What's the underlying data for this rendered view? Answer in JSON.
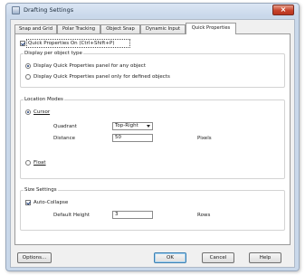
{
  "window": {
    "title": "Drafting Settings",
    "close_glyph": "×"
  },
  "tabs": [
    {
      "label": "Snap and Grid"
    },
    {
      "label": "Polar Tracking"
    },
    {
      "label": "Object Snap"
    },
    {
      "label": "Dynamic Input"
    },
    {
      "label": "Quick Properties"
    }
  ],
  "quick_properties": {
    "enable_label": "Quick Properties On (Ctrl+Shift+P)",
    "enable_checked": true,
    "display_group": {
      "title": "Display per object type",
      "options": [
        {
          "label": "Display Quick Properties panel for any object",
          "selected": true
        },
        {
          "label": "Display Quick Properties panel only for defined objects",
          "selected": false
        }
      ]
    },
    "location_group": {
      "title": "Location Modes",
      "cursor_label": "Cursor",
      "cursor_selected": true,
      "quadrant_label": "Quadrant",
      "quadrant_value": "Top-Right",
      "distance_label": "Distance",
      "distance_value": "50",
      "distance_unit": "Pixels",
      "float_label": "Float",
      "float_selected": false
    },
    "size_group": {
      "title": "Size Settings",
      "auto_collapse_label": "Auto-Collapse",
      "auto_collapse_checked": true,
      "height_label": "Default Height",
      "height_value": "3",
      "height_unit": "Rows"
    }
  },
  "buttons": {
    "options": "Options...",
    "ok": "OK",
    "cancel": "Cancel",
    "help": "Help"
  }
}
